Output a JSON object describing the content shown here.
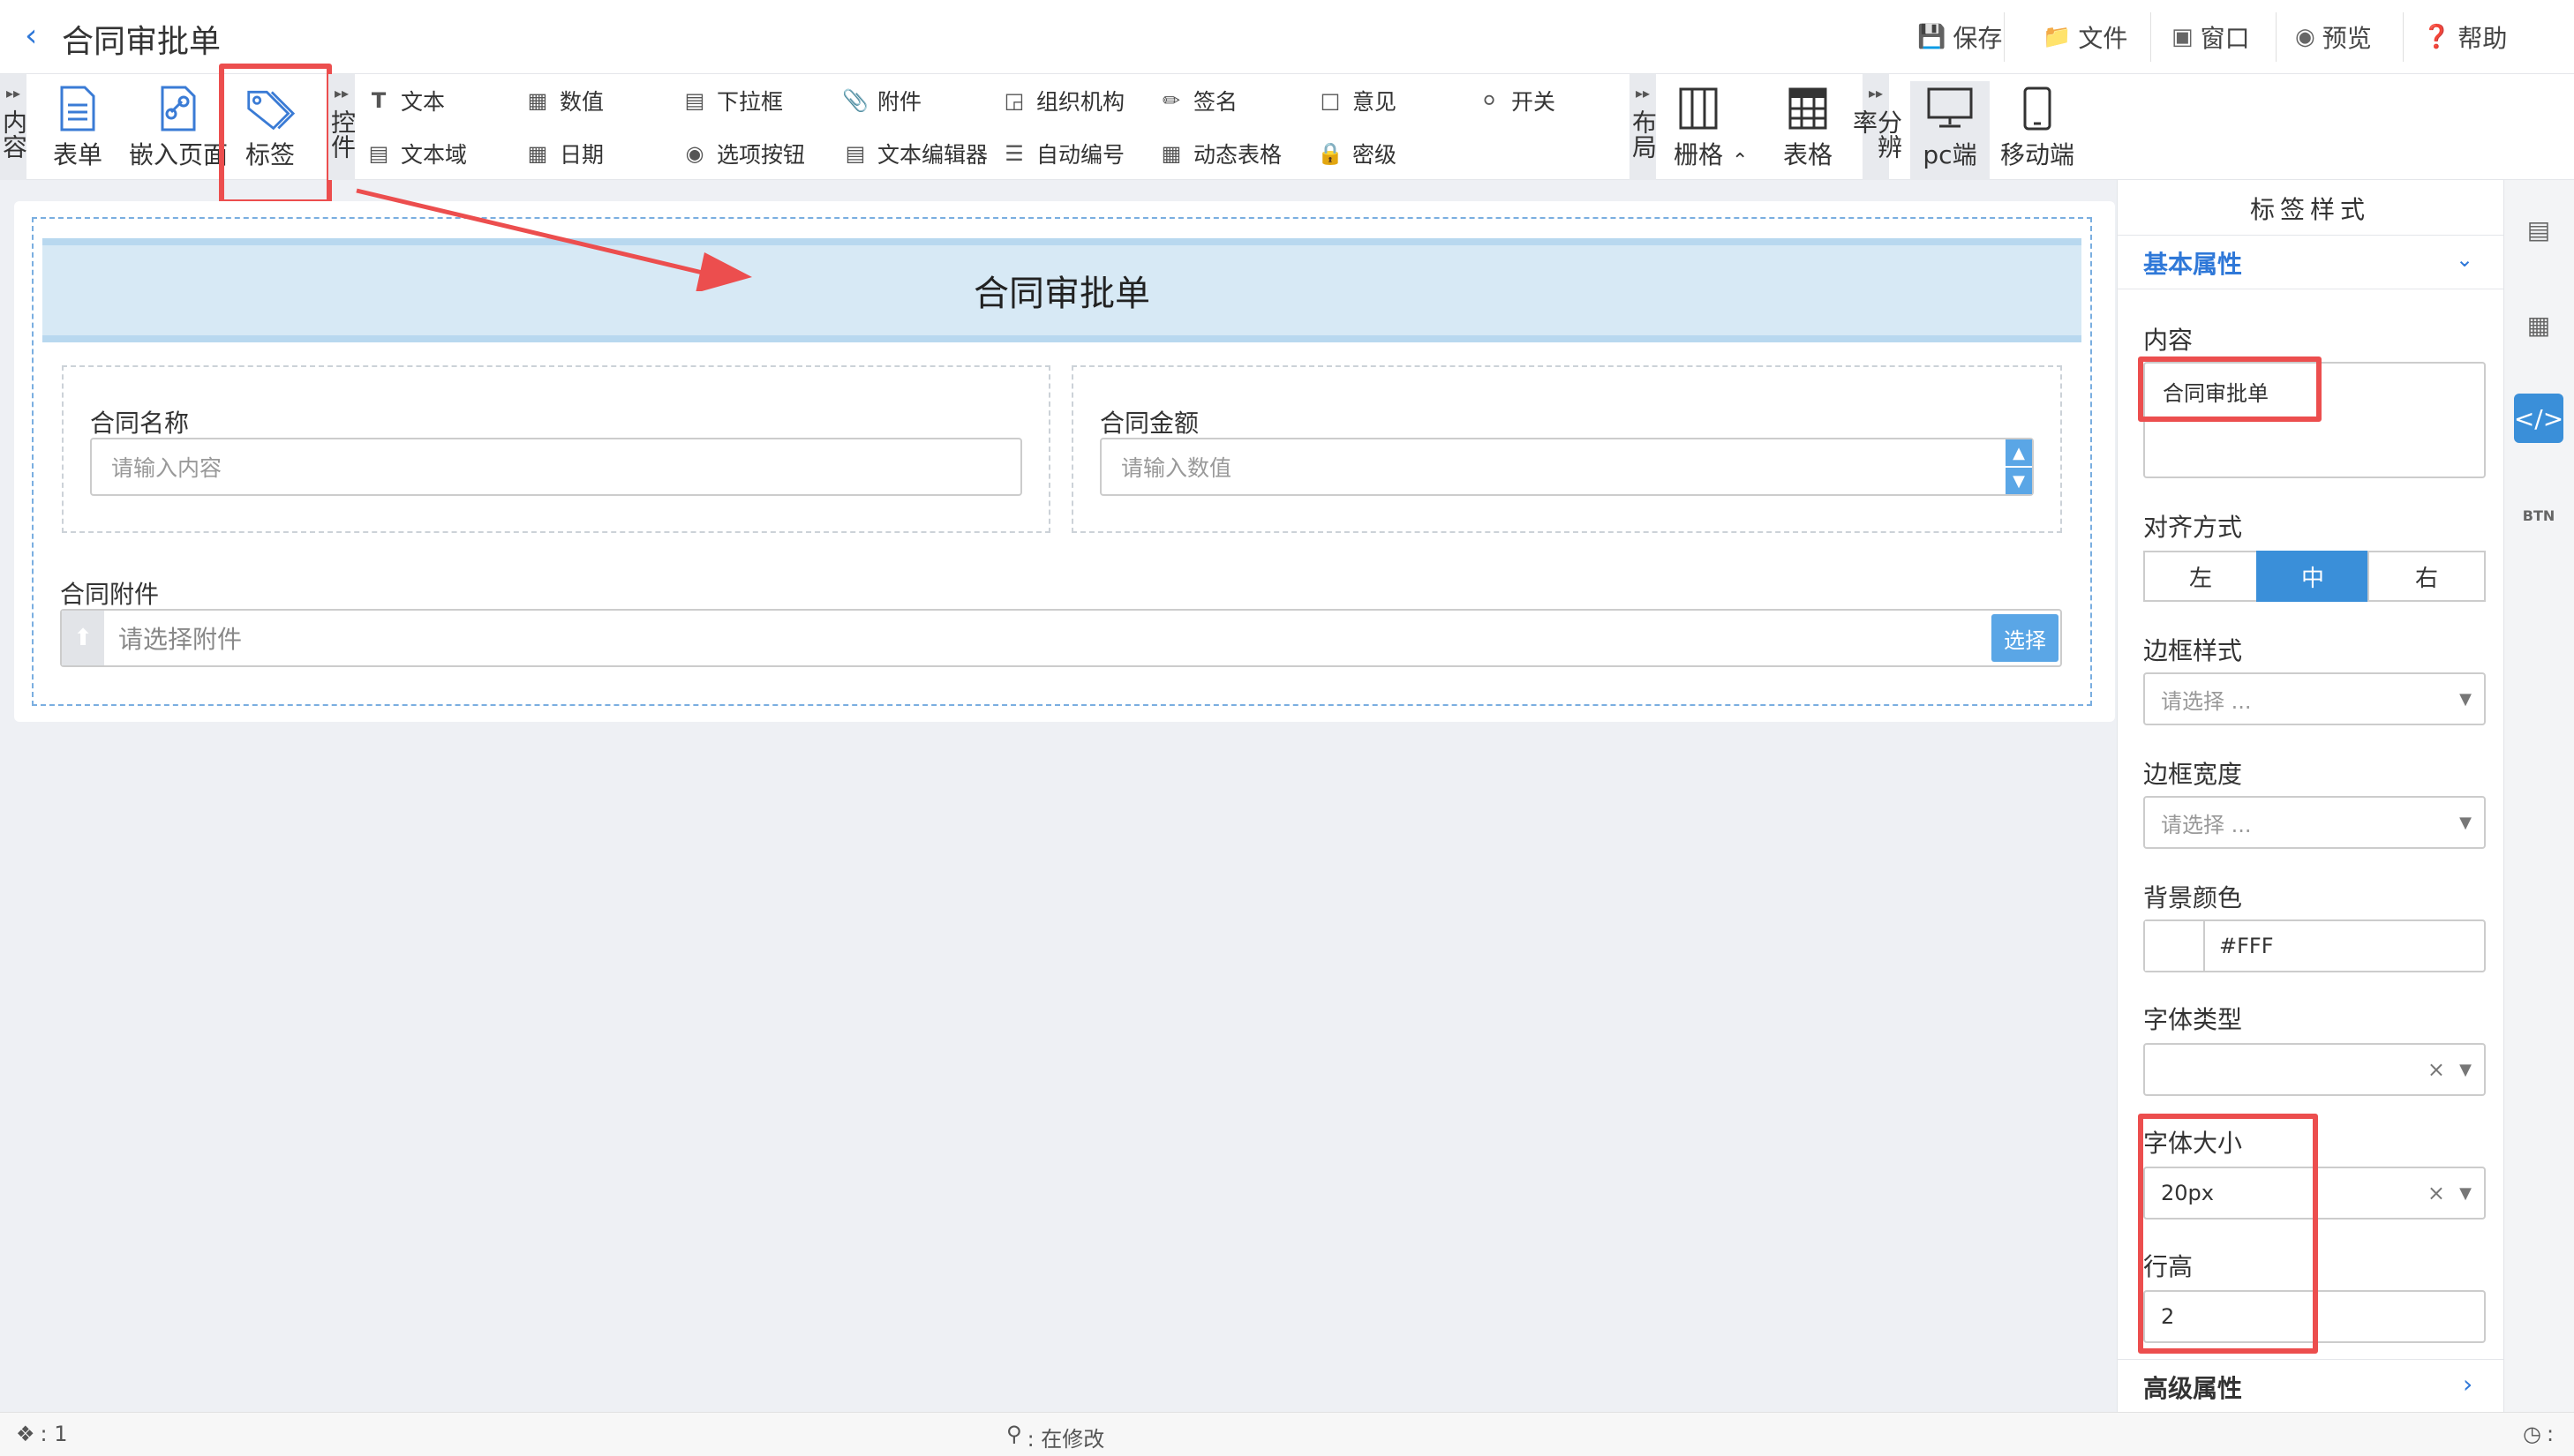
{
  "header": {
    "title": "合同审批单",
    "buttons": [
      "保存",
      "文件",
      "窗口",
      "预览",
      "帮助"
    ]
  },
  "toolbar": {
    "groups": {
      "content": "内容",
      "controls": "控件",
      "layout": "布局",
      "resolution": "分辨率"
    },
    "big": {
      "form": "表单",
      "embed": "嵌入页面",
      "label": "标签",
      "grid": "栅格",
      "table": "表格",
      "pc": "pc端",
      "mobile": "移动端"
    },
    "row1": [
      "文本",
      "数值",
      "下拉框",
      "附件",
      "组织机构",
      "签名",
      "意见",
      "开关"
    ],
    "row2": [
      "文本域",
      "日期",
      "选项按钮",
      "文本编辑器",
      "自动编号",
      "动态表格",
      "密级"
    ]
  },
  "form": {
    "label_text": "合同审批单",
    "contract_name": {
      "label": "合同名称",
      "placeholder": "请输入内容"
    },
    "contract_amount": {
      "label": "合同金额",
      "placeholder": "请输入数值"
    },
    "attachment": {
      "label": "合同附件",
      "placeholder": "请选择附件",
      "button": "选择"
    }
  },
  "panel": {
    "title": "标签样式",
    "basic_section": "基本属性",
    "content_label": "内容",
    "content_value": "合同审批单",
    "align_label": "对齐方式",
    "align_options": [
      "左",
      "中",
      "右"
    ],
    "align_selected": "中",
    "border_style_label": "边框样式",
    "border_style_placeholder": "请选择 ...",
    "border_width_label": "边框宽度",
    "border_width_placeholder": "请选择 ...",
    "bg_color_label": "背景颜色",
    "bg_color_value": "#FFF",
    "font_type_label": "字体类型",
    "font_size_label": "字体大小",
    "font_size_value": "20px",
    "line_height_label": "行高",
    "line_height_value": "2",
    "advanced_section": "高级属性"
  },
  "status": {
    "count": ": 1",
    "state": ": 在修改",
    "right": ":"
  },
  "colors": {
    "accent": "#3a8fd9",
    "highlight": "#ec4e4e",
    "label_bg": "#d7e9f5"
  }
}
